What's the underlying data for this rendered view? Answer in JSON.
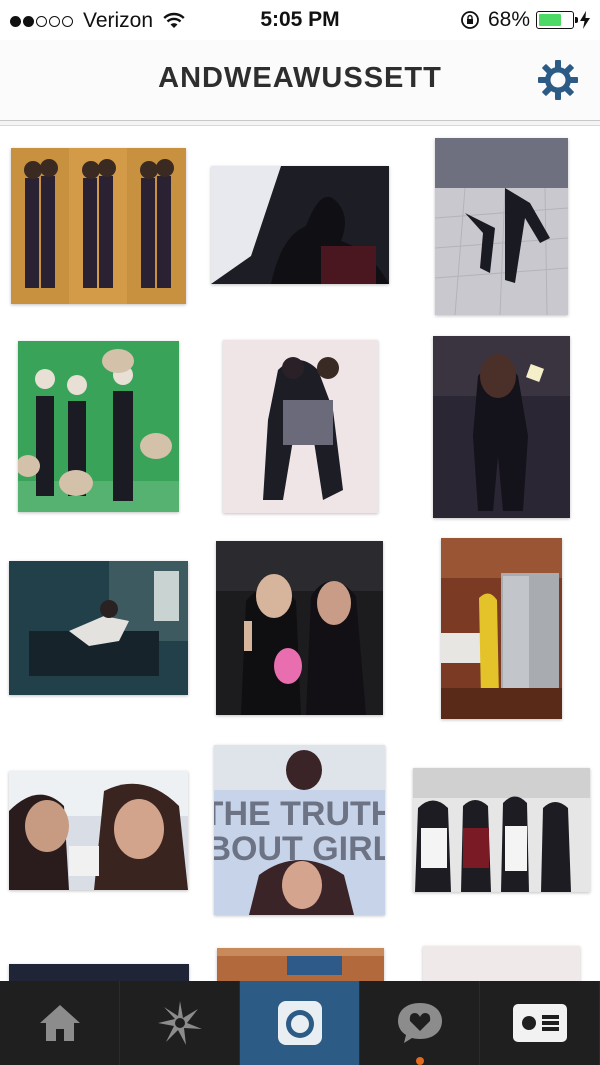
{
  "status_bar": {
    "carrier": "Verizon",
    "time": "5:05 PM",
    "battery_percent": "68%",
    "battery_level": 0.68,
    "signal_bars_filled": 2,
    "signal_bars_total": 5
  },
  "header": {
    "title": "ANDWEAWUSSETT",
    "settings_icon": "gear-icon",
    "accent_color": "#2c5c86"
  },
  "grid": {
    "overlay_text_photo_11_line1": "THE TRUTH",
    "overlay_text_photo_11_line2": "ABOUT GIRLS"
  },
  "tab_bar": {
    "tabs": [
      {
        "icon": "home-icon",
        "active": false
      },
      {
        "icon": "explore-star-icon",
        "active": false
      },
      {
        "icon": "camera-icon",
        "active": true
      },
      {
        "icon": "activity-heart-bubble-icon",
        "active": false,
        "notification": true
      },
      {
        "icon": "profile-card-icon",
        "active": false
      }
    ]
  }
}
